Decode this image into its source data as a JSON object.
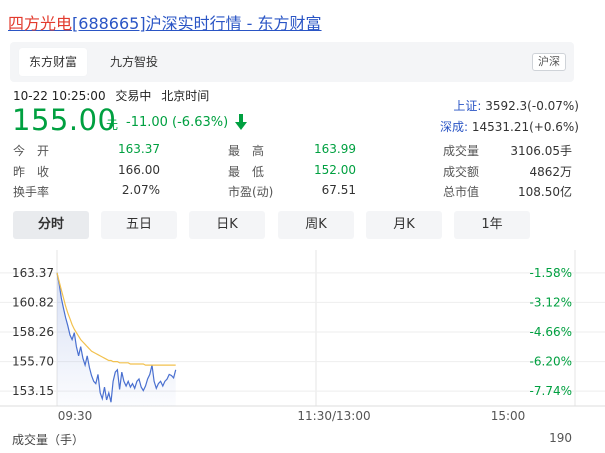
{
  "header": {
    "name": "四方光电",
    "code": "[688665]",
    "suffix": "沪深实时行情 - 东方财富"
  },
  "source_tabs": [
    "东方财富",
    "九方智投"
  ],
  "market_badge": "沪深",
  "status": {
    "time": "10-22 10:25:00",
    "trading": "交易中",
    "tz": "北京时间"
  },
  "quote": {
    "price": "155.00",
    "unit": "元",
    "change": "-11.00 (-6.63%)"
  },
  "indices": [
    {
      "label": "上证:",
      "value": "3592.3(-0.07%)"
    },
    {
      "label": "深成:",
      "value": "14531.21(+0.6%)"
    }
  ],
  "stats": {
    "open_label": "今　开",
    "open": "163.37",
    "prev_label": "昨　收",
    "prev": "166.00",
    "turnover_label": "换手率",
    "turnover": "2.07%",
    "high_label": "最　高",
    "high": "163.99",
    "low_label": "最　低",
    "low": "152.00",
    "pe_label": "市盈(动)",
    "pe": "67.51",
    "vol_label": "成交量",
    "vol": "3106.05手",
    "amt_label": "成交额",
    "amt": "4862万",
    "mcap_label": "总市值",
    "mcap": "108.50亿"
  },
  "period_tabs": [
    "分时",
    "五日",
    "日K",
    "周K",
    "月K",
    "1年"
  ],
  "chart_data": {
    "type": "line",
    "y_ticks": [
      "163.37",
      "160.82",
      "158.26",
      "155.70",
      "153.15"
    ],
    "pct_ticks": [
      "-1.58%",
      "-3.12%",
      "-4.66%",
      "-6.20%",
      "-7.74%"
    ],
    "x_ticks": [
      "09:30",
      "11:30/13:00",
      "15:00"
    ],
    "ylim": [
      151.87,
      164.65
    ],
    "sessions_minutes": 240,
    "series": [
      {
        "name": "price",
        "color": "#4a70d0",
        "values": [
          163.37,
          162.4,
          161.2,
          160.3,
          159.5,
          158.8,
          158.0,
          157.6,
          158.2,
          157.0,
          156.2,
          157.0,
          156.0,
          155.4,
          156.2,
          155.2,
          154.5,
          154.0,
          153.8,
          154.6,
          153.0,
          152.5,
          153.5,
          152.4,
          153.0,
          152.2,
          154.0,
          154.8,
          155.0,
          153.3,
          154.8,
          154.0,
          153.6,
          154.0,
          153.5,
          153.8,
          153.4,
          154.0,
          154.2,
          153.5,
          153.2,
          153.6,
          154.2,
          154.6,
          155.4,
          154.0,
          153.4,
          153.8,
          154.0,
          153.6,
          154.0,
          154.2,
          154.6,
          154.5,
          154.3,
          155.0
        ]
      },
      {
        "name": "average",
        "color": "#f2c14e",
        "values": [
          163.37,
          162.6,
          161.9,
          161.2,
          160.5,
          159.9,
          159.4,
          158.9,
          158.5,
          158.2,
          157.9,
          157.6,
          157.4,
          157.2,
          157.0,
          156.8,
          156.6,
          156.5,
          156.4,
          156.3,
          156.2,
          156.1,
          156.0,
          155.9,
          155.8,
          155.8,
          155.7,
          155.7,
          155.7,
          155.6,
          155.6,
          155.6,
          155.6,
          155.6,
          155.5,
          155.5,
          155.5,
          155.5,
          155.5,
          155.5,
          155.5,
          155.4,
          155.4,
          155.4,
          155.4,
          155.4,
          155.4,
          155.4,
          155.4,
          155.4,
          155.4,
          155.4,
          155.4,
          155.4,
          155.4,
          155.4
        ]
      }
    ]
  },
  "volume": {
    "label": "成交量（手）",
    "max": "190"
  },
  "colors": {
    "down": "#00a040",
    "link": "#2a55c5",
    "name_red": "#e23b2e"
  }
}
